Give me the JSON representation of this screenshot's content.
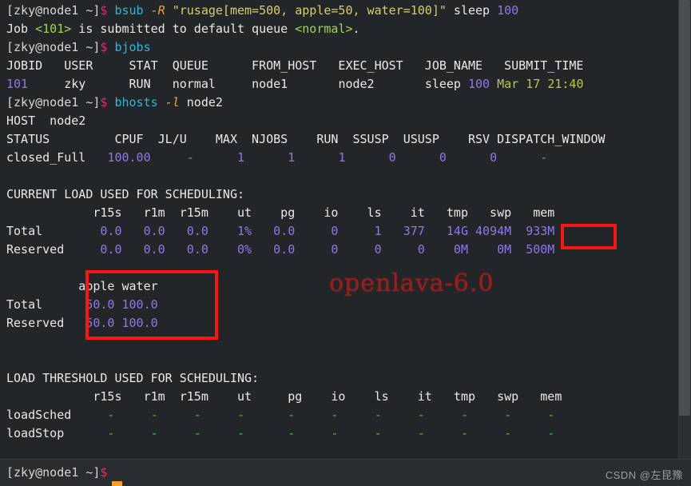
{
  "terminal": {
    "prompt": "[zky@node1 ~]$",
    "prompt_user_host": "[zky@node1 ~]",
    "prompt_symbol": "$"
  },
  "lines": {
    "cmd1_prompt": "[zky@node1 ~]",
    "cmd1_dollar": "$",
    "cmd1_cmd": "bsub",
    "cmd1_flag": "-R",
    "cmd1_arg": "\"rusage[mem=500, apple=50, water=100]\"",
    "cmd1_sleep": "sleep",
    "cmd1_num": "100",
    "out1_a": "Job ",
    "out1_jobid": "<101>",
    "out1_b": " is submitted to default queue ",
    "out1_queue": "<normal>",
    "out1_c": ".",
    "cmd2_cmd": "bjobs",
    "bjobs_header": "JOBID   USER     STAT  QUEUE      FROM_HOST   EXEC_HOST   JOB_NAME   SUBMIT_TIME",
    "bjobs_row_jobid": "101",
    "bjobs_row_user": "zky",
    "bjobs_row_stat": "RUN",
    "bjobs_row_queue": "normal",
    "bjobs_row_from": "node1",
    "bjobs_row_exec": "node2",
    "bjobs_row_jobname": "sleep",
    "bjobs_row_jobnum": "100",
    "bjobs_row_time": "Mar 17 21:40",
    "cmd3_cmd": "bhosts",
    "cmd3_flag": "-l",
    "cmd3_arg": "node2",
    "host_line": "HOST  node2",
    "status_header": "STATUS         CPUF  JL/U    MAX  NJOBS    RUN  SSUSP  USUSP    RSV DISPATCH_WINDOW",
    "status_name": "closed_Full",
    "status_cpuf": "100.00",
    "status_jlu": "-",
    "status_max": "1",
    "status_njobs": "1",
    "status_run": "1",
    "status_ssusp": "0",
    "status_ususp": "0",
    "status_rsv": "0",
    "status_dispatch": "-",
    "current_load_title": "CURRENT LOAD USED FOR SCHEDULING:",
    "load_header": "            r15s   r1m  r15m    ut    pg    io    ls    it   tmp   swp   mem",
    "total_label": "Total",
    "total_values": "        0.0   0.0   0.0    1%   0.0     0     1   377   14G 4094M  933M",
    "reserved_label": "Reserved",
    "reserved_values": "     0.0   0.0   0.0    0%   0.0     0     0     0    0M    0M  500M",
    "res_header": "          apple water",
    "res_total_label": "Total",
    "res_total_values": "      50.0 100.0",
    "res_reserved_label": "Reserved",
    "res_reserved_values": "   50.0 100.0",
    "threshold_title": "LOAD THRESHOLD USED FOR SCHEDULING:",
    "threshold_header": "            r15s   r1m  r15m    ut     pg    io    ls    it   tmp   swp   mem",
    "loadsched_label": "loadSched",
    "loadsched_values": "     -     -     -     -      -     -     -     -     -     -     -",
    "loadstop_label": "loadStop",
    "loadstop_values": "      -     -     -     -      -     -     -     -     -     -     -"
  },
  "annotations": {
    "watermark_openlava": "openlava-6.0",
    "watermark_csdn": "CSDN @左昆豫",
    "highlight_color": "#ff1414",
    "highlight_mem_value": "500M",
    "highlight_resource_block": "apple water 50.0 100.0"
  },
  "table_data": {
    "bjobs": {
      "columns": [
        "JOBID",
        "USER",
        "STAT",
        "QUEUE",
        "FROM_HOST",
        "EXEC_HOST",
        "JOB_NAME",
        "SUBMIT_TIME"
      ],
      "rows": [
        [
          "101",
          "zky",
          "RUN",
          "normal",
          "node1",
          "node2",
          "sleep 100",
          "Mar 17 21:40"
        ]
      ]
    },
    "bhosts_status": {
      "columns": [
        "STATUS",
        "CPUF",
        "JL/U",
        "MAX",
        "NJOBS",
        "RUN",
        "SSUSP",
        "USUSP",
        "RSV",
        "DISPATCH_WINDOW"
      ],
      "rows": [
        [
          "closed_Full",
          "100.00",
          "-",
          "1",
          "1",
          "1",
          "0",
          "0",
          "0",
          "-"
        ]
      ]
    },
    "current_load": {
      "columns": [
        "",
        "r15s",
        "r1m",
        "r15m",
        "ut",
        "pg",
        "io",
        "ls",
        "it",
        "tmp",
        "swp",
        "mem"
      ],
      "rows": [
        [
          "Total",
          "0.0",
          "0.0",
          "0.0",
          "1%",
          "0.0",
          "0",
          "1",
          "377",
          "14G",
          "4094M",
          "933M"
        ],
        [
          "Reserved",
          "0.0",
          "0.0",
          "0.0",
          "0%",
          "0.0",
          "0",
          "0",
          "0",
          "0M",
          "0M",
          "500M"
        ]
      ]
    },
    "custom_resources": {
      "columns": [
        "",
        "apple",
        "water"
      ],
      "rows": [
        [
          "Total",
          "50.0",
          "100.0"
        ],
        [
          "Reserved",
          "50.0",
          "100.0"
        ]
      ]
    },
    "load_threshold": {
      "columns": [
        "",
        "r15s",
        "r1m",
        "r15m",
        "ut",
        "pg",
        "io",
        "ls",
        "it",
        "tmp",
        "swp",
        "mem"
      ],
      "rows": [
        [
          "loadSched",
          "-",
          "-",
          "-",
          "-",
          "-",
          "-",
          "-",
          "-",
          "-",
          "-",
          "-"
        ],
        [
          "loadStop",
          "-",
          "-",
          "-",
          "-",
          "-",
          "-",
          "-",
          "-",
          "-",
          "-",
          "-"
        ]
      ]
    }
  },
  "colors": {
    "background": "#232629",
    "foreground": "#e9e9e9",
    "cyan": "#29b8db",
    "magenta": "#e8276f",
    "orange": "#e8a33d",
    "yellow": "#d7cf6a",
    "purple": "#8c7ae6",
    "green": "#6ab04c",
    "red_annotation": "#ff1414",
    "cursor": "#f0a030"
  }
}
